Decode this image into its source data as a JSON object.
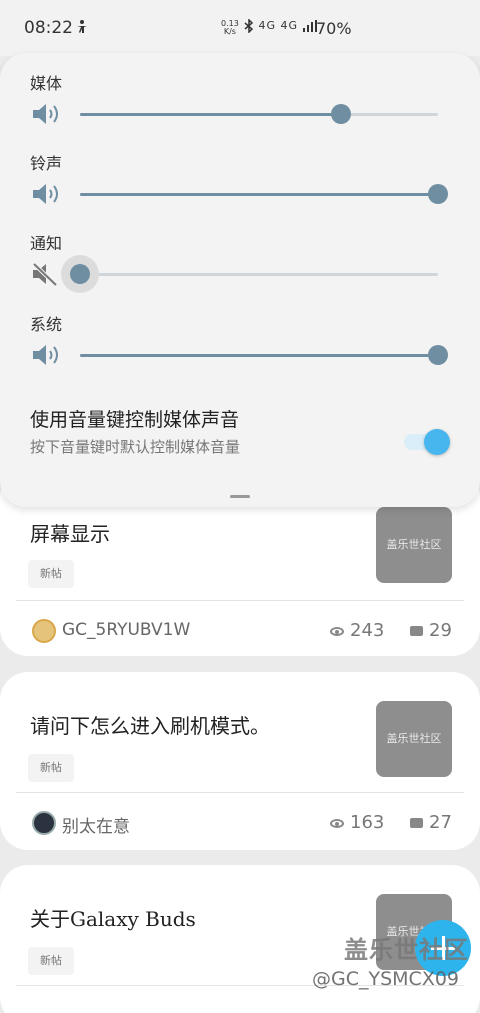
{
  "status_bar": {
    "time": "08:22",
    "net_speed_value": "0.13",
    "net_speed_unit": "K/s",
    "network": "4G 4G",
    "battery": "70%"
  },
  "volume_panel": {
    "sliders": [
      {
        "label": "媒体",
        "level": 0.73,
        "muted": false
      },
      {
        "label": "铃声",
        "level": 1.0,
        "muted": false
      },
      {
        "label": "通知",
        "level": 0.0,
        "muted": true
      },
      {
        "label": "系统",
        "level": 1.0,
        "muted": false
      }
    ],
    "option_title": "使用音量键控制媒体声音",
    "option_subtitle": "按下音量键时默认控制媒体音量",
    "option_enabled": true,
    "accent_color": "#6f8ea1",
    "toggle_color": "#47b5ee"
  },
  "posts": [
    {
      "title": "屏幕显示",
      "tag": "新帖",
      "thumb_text": "盖乐世社区",
      "author": "GC_5RYUBV1W",
      "views": "243",
      "comments": "29"
    },
    {
      "title": "请问下怎么进入刷机模式。",
      "tag": "新帖",
      "thumb_text": "盖乐世社区",
      "author": "别太在意",
      "views": "163",
      "comments": "27"
    },
    {
      "title": "关于Galaxy Buds",
      "tag": "新帖",
      "thumb_text": "盖乐世社区"
    }
  ],
  "watermark": {
    "logo": "盖乐世社区",
    "user": "@GC_YSMCX09"
  }
}
